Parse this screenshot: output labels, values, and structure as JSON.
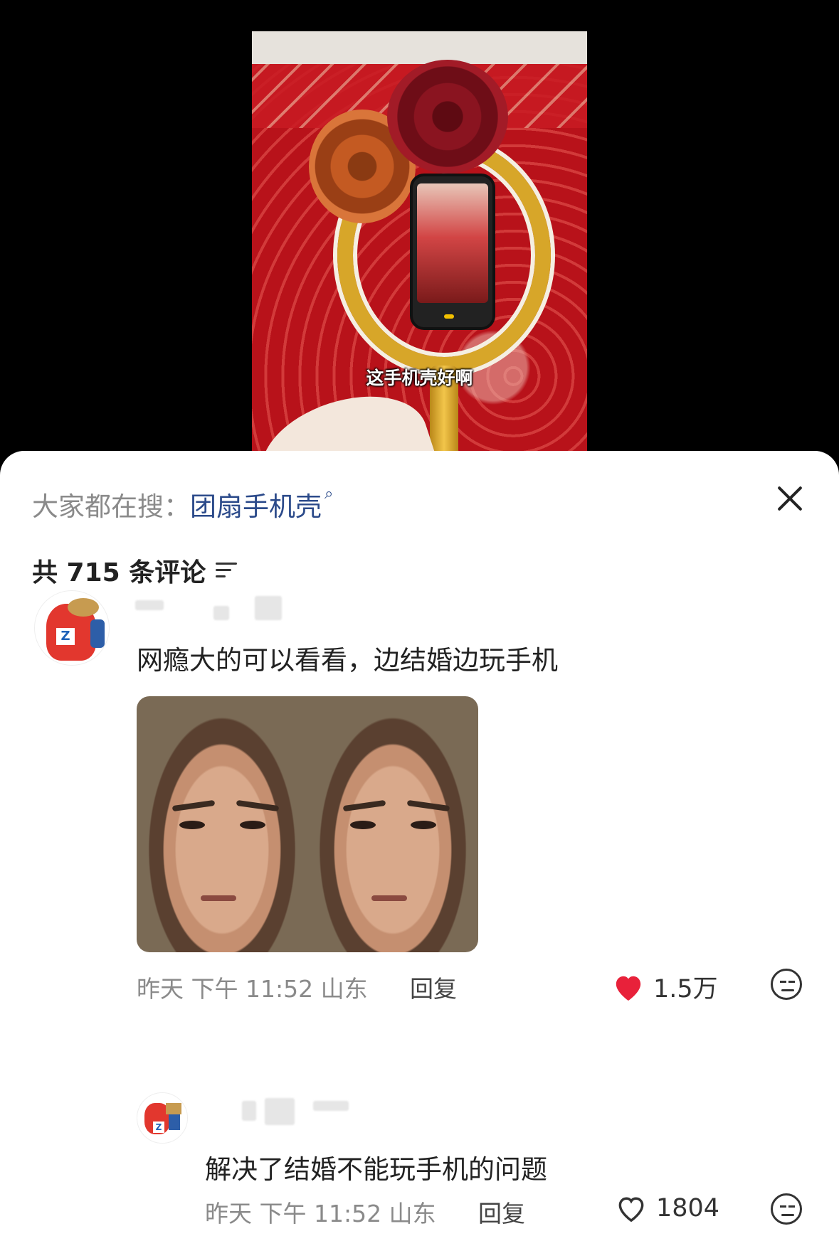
{
  "video": {
    "subtitle": "这手机壳好啊"
  },
  "comments_panel": {
    "search_prefix": "大家都在搜：",
    "search_term": "团扇手机壳",
    "search_icon": "search-icon",
    "comment_count_label": "共 715 条评论",
    "close_icon": "close-icon",
    "filter_icon": "filter-icon"
  },
  "comments": [
    {
      "text": "网瘾大的可以看看，边结婚边玩手机",
      "has_image": true,
      "time": "昨天 下午 11:52",
      "location": "山东",
      "reply_label": "回复",
      "likes": "1.5万",
      "liked": true,
      "replies": [
        {
          "text": "解决了结婚不能玩手机的问题",
          "time": "昨天 下午 11:52",
          "location": "山东",
          "reply_label": "回复",
          "likes": "1804",
          "liked": false
        }
      ]
    }
  ],
  "colors": {
    "search_link": "#2b4a8a",
    "liked_heart": "#e8213a",
    "meta_text": "#8a8a8a"
  }
}
